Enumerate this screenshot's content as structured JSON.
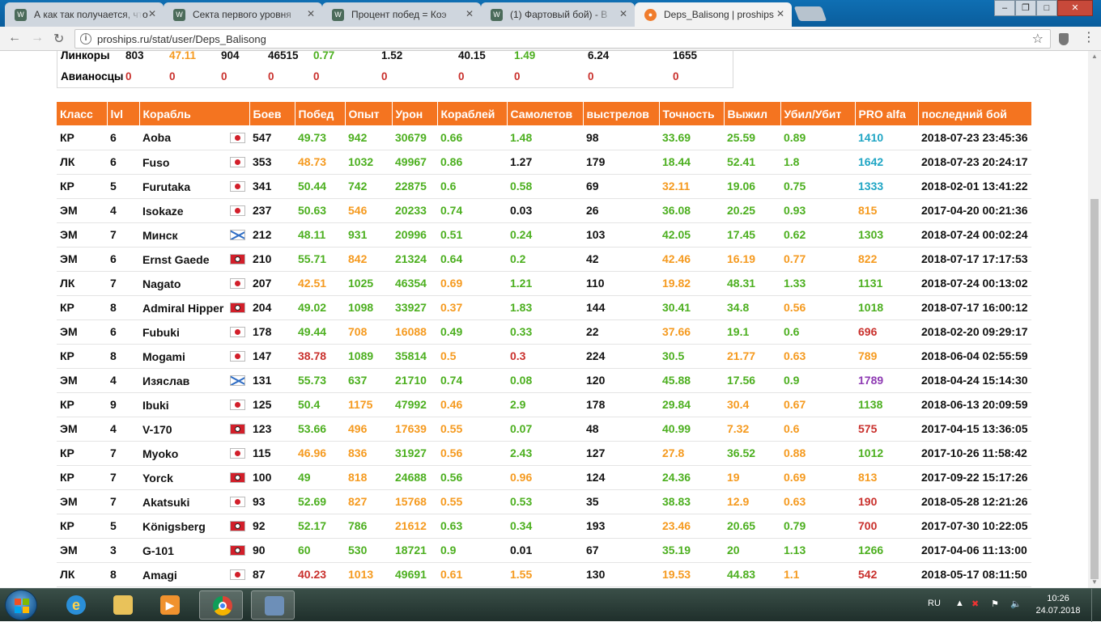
{
  "browser": {
    "tabs": [
      {
        "title": "А как так получается, что",
        "favicon": "wows-icon",
        "active": false
      },
      {
        "title": "Секта первого уровня",
        "favicon": "wows-icon",
        "active": false
      },
      {
        "title": "Процент побед = Коэ",
        "favicon": "wows-icon",
        "active": false
      },
      {
        "title": "(1) Фартовый бой) - В",
        "favicon": "wows-icon",
        "active": false
      },
      {
        "title": "Deps_Balisong | proships",
        "favicon": "proships-icon",
        "active": true
      }
    ],
    "url": "proships.ru/stat/user/Deps_Balisong"
  },
  "summary_rows": [
    {
      "class": "Линкоры",
      "values": [
        "803",
        "47.11",
        "904",
        "46515",
        "0.77",
        "1.52",
        "40.15",
        "1.49",
        "6.24",
        "1655"
      ]
    },
    {
      "class": "Авианосцы",
      "values": [
        "0",
        "0",
        "0",
        "0",
        "0",
        "0",
        "0",
        "0",
        "0",
        "0"
      ]
    }
  ],
  "table": {
    "headers": [
      "Класс",
      "lvl",
      "Корабль",
      "Боев",
      "Побед",
      "Опыт",
      "Урон",
      "Кораблей",
      "Самолетов",
      "выстрелов",
      "Точность",
      "Выжил",
      "Убил/Убит",
      "PRO alfa",
      "последний бой"
    ],
    "rows": [
      {
        "class": "КР",
        "lvl": "6",
        "ship": "Aoba",
        "nation": "japan",
        "battles": "547",
        "wins": "49.73",
        "exp": "942",
        "damage": "30679",
        "ships": "0.66",
        "planes": "1.48",
        "shots": "98",
        "accuracy": "33.69",
        "survived": "25.59",
        "kd": "0.89",
        "pro": "1410",
        "last": "2018-07-23 23:45:36"
      },
      {
        "class": "ЛК",
        "lvl": "6",
        "ship": "Fuso",
        "nation": "japan",
        "battles": "353",
        "wins": "48.73",
        "exp": "1032",
        "damage": "49967",
        "ships": "0.86",
        "planes": "1.27",
        "shots": "179",
        "accuracy": "18.44",
        "survived": "52.41",
        "kd": "1.8",
        "pro": "1642",
        "last": "2018-07-23 20:24:17"
      },
      {
        "class": "КР",
        "lvl": "5",
        "ship": "Furutaka",
        "nation": "japan",
        "battles": "341",
        "wins": "50.44",
        "exp": "742",
        "damage": "22875",
        "ships": "0.6",
        "planes": "0.58",
        "shots": "69",
        "accuracy": "32.11",
        "survived": "19.06",
        "kd": "0.75",
        "pro": "1333",
        "last": "2018-02-01 13:41:22"
      },
      {
        "class": "ЭМ",
        "lvl": "4",
        "ship": "Isokaze",
        "nation": "japan",
        "battles": "237",
        "wins": "50.63",
        "exp": "546",
        "damage": "20233",
        "ships": "0.74",
        "planes": "0.03",
        "shots": "26",
        "accuracy": "36.08",
        "survived": "20.25",
        "kd": "0.93",
        "pro": "815",
        "last": "2017-04-20 00:21:36"
      },
      {
        "class": "ЭМ",
        "lvl": "7",
        "ship": "Минск",
        "nation": "ussr",
        "battles": "212",
        "wins": "48.11",
        "exp": "931",
        "damage": "20996",
        "ships": "0.51",
        "planes": "0.24",
        "shots": "103",
        "accuracy": "42.05",
        "survived": "17.45",
        "kd": "0.62",
        "pro": "1303",
        "last": "2018-07-24 00:02:24"
      },
      {
        "class": "ЭМ",
        "lvl": "6",
        "ship": "Ernst Gaede",
        "nation": "germany",
        "battles": "210",
        "wins": "55.71",
        "exp": "842",
        "damage": "21324",
        "ships": "0.64",
        "planes": "0.2",
        "shots": "42",
        "accuracy": "42.46",
        "survived": "16.19",
        "kd": "0.77",
        "pro": "822",
        "last": "2018-07-17 17:17:53"
      },
      {
        "class": "ЛК",
        "lvl": "7",
        "ship": "Nagato",
        "nation": "japan",
        "battles": "207",
        "wins": "42.51",
        "exp": "1025",
        "damage": "46354",
        "ships": "0.69",
        "planes": "1.21",
        "shots": "110",
        "accuracy": "19.82",
        "survived": "48.31",
        "kd": "1.33",
        "pro": "1131",
        "last": "2018-07-24 00:13:02"
      },
      {
        "class": "КР",
        "lvl": "8",
        "ship": "Admiral Hipper",
        "nation": "germany",
        "battles": "204",
        "wins": "49.02",
        "exp": "1098",
        "damage": "33927",
        "ships": "0.37",
        "planes": "1.83",
        "shots": "144",
        "accuracy": "30.41",
        "survived": "34.8",
        "kd": "0.56",
        "pro": "1018",
        "last": "2018-07-17 16:00:12"
      },
      {
        "class": "ЭМ",
        "lvl": "6",
        "ship": "Fubuki",
        "nation": "japan",
        "battles": "178",
        "wins": "49.44",
        "exp": "708",
        "damage": "16088",
        "ships": "0.49",
        "planes": "0.33",
        "shots": "22",
        "accuracy": "37.66",
        "survived": "19.1",
        "kd": "0.6",
        "pro": "696",
        "last": "2018-02-20 09:29:17"
      },
      {
        "class": "КР",
        "lvl": "8",
        "ship": "Mogami",
        "nation": "japan",
        "battles": "147",
        "wins": "38.78",
        "exp": "1089",
        "damage": "35814",
        "ships": "0.5",
        "planes": "0.3",
        "shots": "224",
        "accuracy": "30.5",
        "survived": "21.77",
        "kd": "0.63",
        "pro": "789",
        "last": "2018-06-04 02:55:59"
      },
      {
        "class": "ЭМ",
        "lvl": "4",
        "ship": "Изяслав",
        "nation": "ussr",
        "battles": "131",
        "wins": "55.73",
        "exp": "637",
        "damage": "21710",
        "ships": "0.74",
        "planes": "0.08",
        "shots": "120",
        "accuracy": "45.88",
        "survived": "17.56",
        "kd": "0.9",
        "pro": "1789",
        "last": "2018-04-24 15:14:30"
      },
      {
        "class": "КР",
        "lvl": "9",
        "ship": "Ibuki",
        "nation": "japan",
        "battles": "125",
        "wins": "50.4",
        "exp": "1175",
        "damage": "47992",
        "ships": "0.46",
        "planes": "2.9",
        "shots": "178",
        "accuracy": "29.84",
        "survived": "30.4",
        "kd": "0.67",
        "pro": "1138",
        "last": "2018-06-13 20:09:59"
      },
      {
        "class": "ЭМ",
        "lvl": "4",
        "ship": "V-170",
        "nation": "germany",
        "battles": "123",
        "wins": "53.66",
        "exp": "496",
        "damage": "17639",
        "ships": "0.55",
        "planes": "0.07",
        "shots": "48",
        "accuracy": "40.99",
        "survived": "7.32",
        "kd": "0.6",
        "pro": "575",
        "last": "2017-04-15 13:36:05"
      },
      {
        "class": "КР",
        "lvl": "7",
        "ship": "Myoko",
        "nation": "japan",
        "battles": "115",
        "wins": "46.96",
        "exp": "836",
        "damage": "31927",
        "ships": "0.56",
        "planes": "2.43",
        "shots": "127",
        "accuracy": "27.8",
        "survived": "36.52",
        "kd": "0.88",
        "pro": "1012",
        "last": "2017-10-26 11:58:42"
      },
      {
        "class": "КР",
        "lvl": "7",
        "ship": "Yorck",
        "nation": "germany",
        "battles": "100",
        "wins": "49",
        "exp": "818",
        "damage": "24688",
        "ships": "0.56",
        "planes": "0.96",
        "shots": "124",
        "accuracy": "24.36",
        "survived": "19",
        "kd": "0.69",
        "pro": "813",
        "last": "2017-09-22 15:17:26"
      },
      {
        "class": "ЭМ",
        "lvl": "7",
        "ship": "Akatsuki",
        "nation": "japan",
        "battles": "93",
        "wins": "52.69",
        "exp": "827",
        "damage": "15768",
        "ships": "0.55",
        "planes": "0.53",
        "shots": "35",
        "accuracy": "38.83",
        "survived": "12.9",
        "kd": "0.63",
        "pro": "190",
        "last": "2018-05-28 12:21:26"
      },
      {
        "class": "КР",
        "lvl": "5",
        "ship": "Königsberg",
        "nation": "germany",
        "battles": "92",
        "wins": "52.17",
        "exp": "786",
        "damage": "21612",
        "ships": "0.63",
        "planes": "0.34",
        "shots": "193",
        "accuracy": "23.46",
        "survived": "20.65",
        "kd": "0.79",
        "pro": "700",
        "last": "2017-07-30 10:22:05"
      },
      {
        "class": "ЭМ",
        "lvl": "3",
        "ship": "G-101",
        "nation": "germany",
        "battles": "90",
        "wins": "60",
        "exp": "530",
        "damage": "18721",
        "ships": "0.9",
        "planes": "0.01",
        "shots": "67",
        "accuracy": "35.19",
        "survived": "20",
        "kd": "1.13",
        "pro": "1266",
        "last": "2017-04-06 11:13:00"
      },
      {
        "class": "ЛК",
        "lvl": "8",
        "ship": "Amagi",
        "nation": "japan",
        "battles": "87",
        "wins": "40.23",
        "exp": "1013",
        "damage": "49691",
        "ships": "0.61",
        "planes": "1.55",
        "shots": "130",
        "accuracy": "19.53",
        "survived": "44.83",
        "kd": "1.1",
        "pro": "542",
        "last": "2018-05-17 08:11:50"
      }
    ]
  },
  "colors": {
    "header_bg": "#f47420",
    "green": "#4caf1f",
    "orange": "#f59a1f",
    "red": "#c9302c",
    "black": "#111111",
    "teal": "#1fa5c4",
    "purple": "#8e3ab3"
  },
  "cell_colors": [
    [
      "green",
      "green",
      "green",
      "green",
      "green",
      "black",
      "green",
      "green",
      "green",
      "teal"
    ],
    [
      "orange",
      "green",
      "green",
      "green",
      "black",
      "black",
      "green",
      "green",
      "green",
      "teal"
    ],
    [
      "green",
      "green",
      "green",
      "green",
      "green",
      "black",
      "orange",
      "green",
      "green",
      "teal"
    ],
    [
      "green",
      "orange",
      "green",
      "green",
      "black",
      "black",
      "green",
      "green",
      "green",
      "orange"
    ],
    [
      "green",
      "green",
      "green",
      "green",
      "green",
      "black",
      "green",
      "green",
      "green",
      "green"
    ],
    [
      "green",
      "orange",
      "green",
      "green",
      "green",
      "black",
      "orange",
      "orange",
      "orange",
      "orange"
    ],
    [
      "orange",
      "green",
      "green",
      "orange",
      "green",
      "black",
      "orange",
      "green",
      "green",
      "green"
    ],
    [
      "green",
      "green",
      "green",
      "orange",
      "green",
      "black",
      "green",
      "green",
      "orange",
      "green"
    ],
    [
      "green",
      "orange",
      "orange",
      "green",
      "green",
      "black",
      "orange",
      "green",
      "green",
      "red"
    ],
    [
      "red",
      "green",
      "green",
      "orange",
      "red",
      "black",
      "green",
      "orange",
      "orange",
      "orange"
    ],
    [
      "green",
      "green",
      "green",
      "green",
      "green",
      "black",
      "green",
      "green",
      "green",
      "purple"
    ],
    [
      "green",
      "orange",
      "green",
      "orange",
      "green",
      "black",
      "green",
      "orange",
      "orange",
      "green"
    ],
    [
      "green",
      "orange",
      "orange",
      "orange",
      "green",
      "black",
      "green",
      "orange",
      "orange",
      "red"
    ],
    [
      "orange",
      "orange",
      "green",
      "orange",
      "green",
      "black",
      "orange",
      "green",
      "orange",
      "green"
    ],
    [
      "green",
      "orange",
      "green",
      "green",
      "orange",
      "black",
      "green",
      "orange",
      "orange",
      "orange"
    ],
    [
      "green",
      "orange",
      "orange",
      "orange",
      "green",
      "black",
      "green",
      "orange",
      "orange",
      "red"
    ],
    [
      "green",
      "green",
      "orange",
      "green",
      "green",
      "black",
      "orange",
      "green",
      "green",
      "red"
    ],
    [
      "green",
      "green",
      "green",
      "green",
      "black",
      "black",
      "green",
      "green",
      "green",
      "green"
    ],
    [
      "red",
      "orange",
      "green",
      "orange",
      "orange",
      "black",
      "orange",
      "green",
      "orange",
      "red"
    ]
  ],
  "summary_colors": [
    [
      "black",
      "orange",
      "black",
      "black",
      "green",
      "black",
      "black",
      "green",
      "black",
      "black"
    ],
    [
      "red",
      "red",
      "red",
      "red",
      "red",
      "red",
      "red",
      "red",
      "red",
      "red"
    ]
  ],
  "taskbar": {
    "items": [
      "ie-icon",
      "explorer-icon",
      "media-player-icon",
      "chrome-icon",
      "network-app-icon"
    ],
    "lang": "RU",
    "time": "10:26",
    "date": "24.07.2018"
  }
}
